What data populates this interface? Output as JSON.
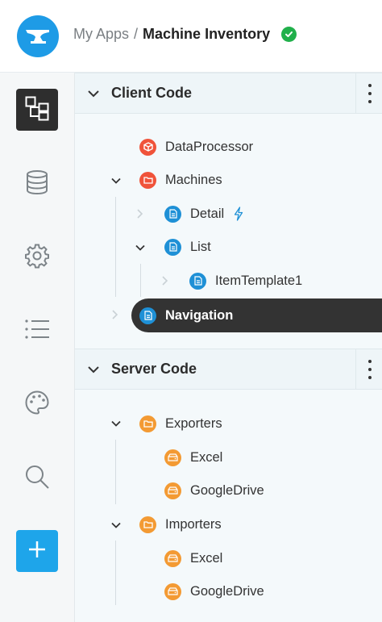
{
  "header": {
    "breadcrumb_parent": "My Apps",
    "breadcrumb_separator": "/",
    "breadcrumb_current": "Machine Inventory",
    "status": "saved"
  },
  "rail": {
    "items": [
      {
        "name": "explorer",
        "icon": "tree-icon",
        "active": true
      },
      {
        "name": "database",
        "icon": "database-icon",
        "active": false
      },
      {
        "name": "settings",
        "icon": "gear-icon",
        "active": false
      },
      {
        "name": "list",
        "icon": "list-icon",
        "active": false
      },
      {
        "name": "theme",
        "icon": "palette-icon",
        "active": false
      },
      {
        "name": "search",
        "icon": "search-icon",
        "active": false
      },
      {
        "name": "add",
        "icon": "plus-icon",
        "active": false
      }
    ]
  },
  "client_code": {
    "title": "Client Code",
    "items": {
      "dataprocessor": "DataProcessor",
      "machines": "Machines",
      "detail": "Detail",
      "list": "List",
      "itemtemplate": "ItemTemplate1",
      "navigation": "Navigation"
    }
  },
  "server_code": {
    "title": "Server Code",
    "items": {
      "exporters": "Exporters",
      "exporters_excel": "Excel",
      "exporters_googledrive": "GoogleDrive",
      "importers": "Importers",
      "importers_excel": "Excel",
      "importers_googledrive": "GoogleDrive"
    }
  },
  "colors": {
    "accent": "#1e9be6",
    "module": "#f0533a",
    "page": "#1e90d6",
    "server": "#f39a33",
    "selected": "#333333",
    "success": "#21b04b"
  }
}
